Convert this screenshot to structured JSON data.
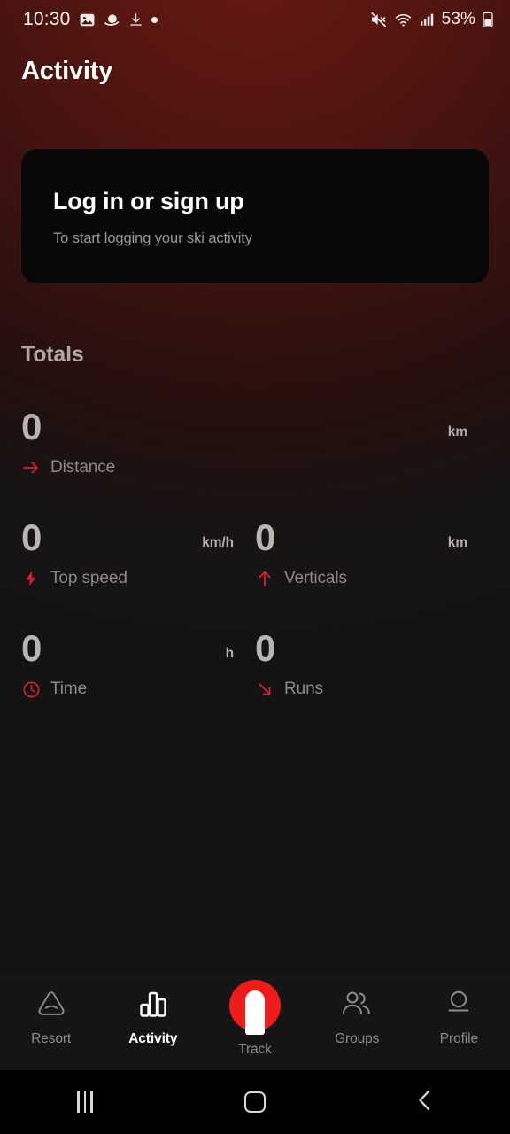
{
  "statusbar": {
    "time": "10:30",
    "battery_percent": "53%",
    "icons_left": [
      "image-icon",
      "saturn-icon",
      "download-icon",
      "dot-indicator"
    ],
    "icons_right": [
      "mute-icon",
      "wifi-icon",
      "signal-icon",
      "battery-icon"
    ]
  },
  "header": {
    "title": "Activity"
  },
  "login_card": {
    "title": "Log in or sign up",
    "subtitle": "To start logging your ski activity"
  },
  "totals": {
    "heading": "Totals",
    "stats": [
      {
        "value": "0",
        "unit": "km",
        "label": "Distance",
        "icon": "arrow-right-icon"
      },
      {
        "value": "0",
        "unit": "km/h",
        "label": "Top speed",
        "icon": "lightning-bolt-icon"
      },
      {
        "value": "0",
        "unit": "km",
        "label": "Verticals",
        "icon": "arrow-up-icon"
      },
      {
        "value": "0",
        "unit": "h",
        "label": "Time",
        "icon": "clock-icon"
      },
      {
        "value": "0",
        "unit": "",
        "label": "Runs",
        "icon": "arrow-down-right-icon"
      }
    ]
  },
  "bottom_nav": {
    "items": [
      {
        "label": "Resort",
        "icon": "mountain-icon",
        "active": false
      },
      {
        "label": "Activity",
        "icon": "bar-chart-icon",
        "active": true
      },
      {
        "label": "Track",
        "icon": "track-icon",
        "active": false
      },
      {
        "label": "Groups",
        "icon": "people-icon",
        "active": false
      },
      {
        "label": "Profile",
        "icon": "person-icon",
        "active": false
      }
    ]
  },
  "system_nav": {
    "recents_label": "recents-button",
    "home_label": "home-button",
    "back_label": "back-button"
  },
  "colors": {
    "accent_red": "#ee1b1b",
    "icon_red": "#d42030",
    "background_top": "#551611",
    "background_bottom": "#141313",
    "card_black": "#090808"
  }
}
